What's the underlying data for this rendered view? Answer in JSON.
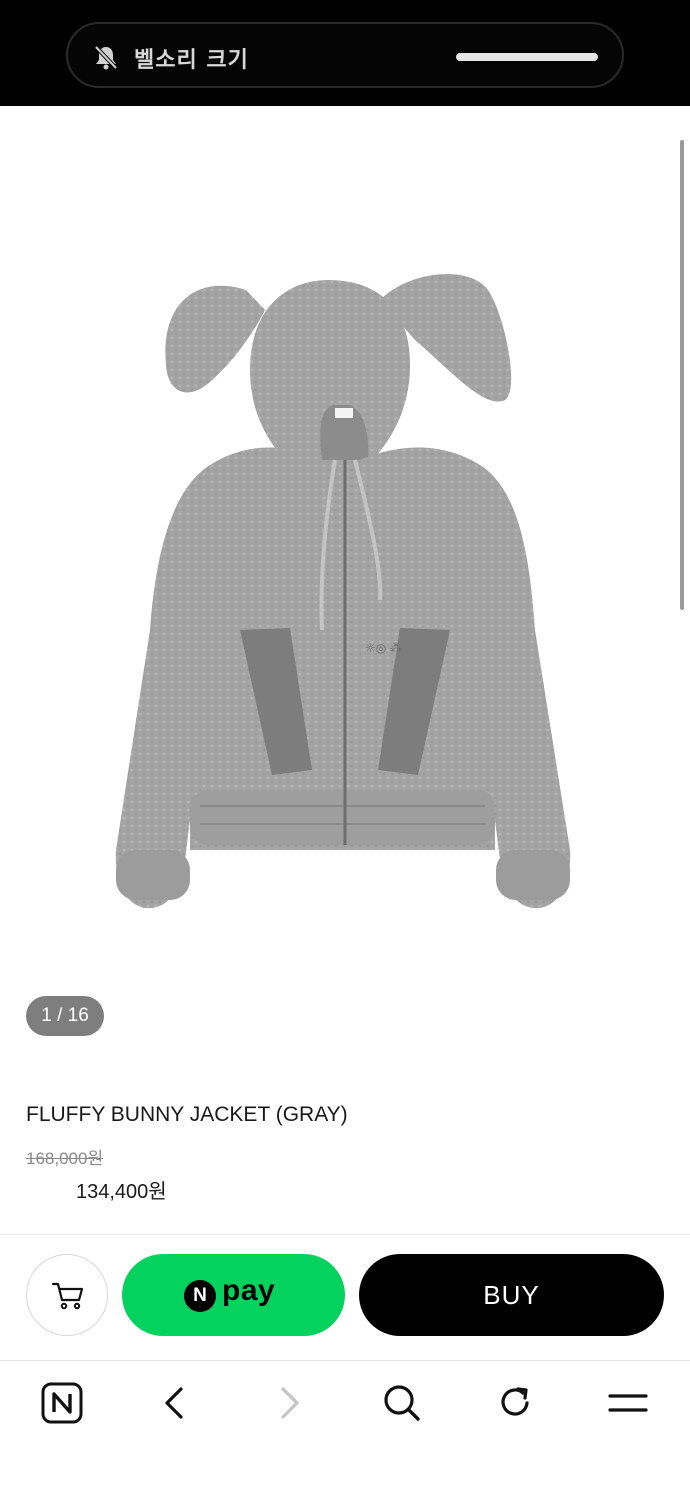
{
  "notification": {
    "text": "벨소리 크기",
    "icon": "bell-muted-icon"
  },
  "gallery": {
    "counter": "1 / 16",
    "product_color": "#a3a3a3"
  },
  "product": {
    "title": "FLUFFY BUNNY JACKET (GRAY)",
    "original_price": "168,000원",
    "sale_price": "134,400원"
  },
  "actions": {
    "cart_icon": "cart-icon",
    "npay_badge": "N",
    "npay_label": "pay",
    "npay_color": "#03d35e",
    "buy_label": "BUY"
  },
  "browser_nav": {
    "items": [
      "naver-home-icon",
      "back-icon",
      "forward-icon",
      "search-icon",
      "refresh-icon",
      "menu-icon"
    ]
  }
}
